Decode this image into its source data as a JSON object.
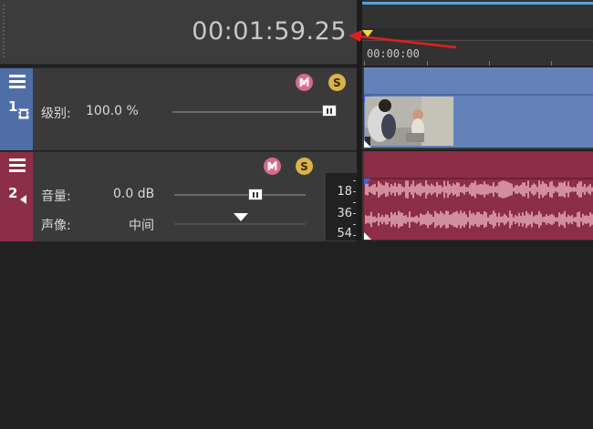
{
  "time_display": {
    "value": "00:01:59.25"
  },
  "ruler": {
    "start_time": "00:00:00"
  },
  "tracks": [
    {
      "number": "1",
      "type": "video",
      "color": "#4f6ea8",
      "mute_icon": "mute-icon",
      "solo_icon": "solo-icon",
      "level": {
        "label": "级别:",
        "value": "100.0 %",
        "fraction": 1.0
      }
    },
    {
      "number": "2",
      "type": "audio",
      "color": "#8c2e45",
      "mute_icon": "mute-icon",
      "solo_icon": "solo-icon",
      "volume": {
        "label": "音量:",
        "value": "0.0 dB"
      },
      "pan": {
        "label": "声像:",
        "value": "中间"
      },
      "meter_labels": [
        "18",
        "36",
        "54"
      ]
    }
  ],
  "badges": {
    "mute": "M",
    "solo": "S"
  },
  "accent": {
    "loop_bar": "#5aa0d8",
    "playhead": "#e8d84a",
    "annotation_arrow": "#e02020"
  }
}
